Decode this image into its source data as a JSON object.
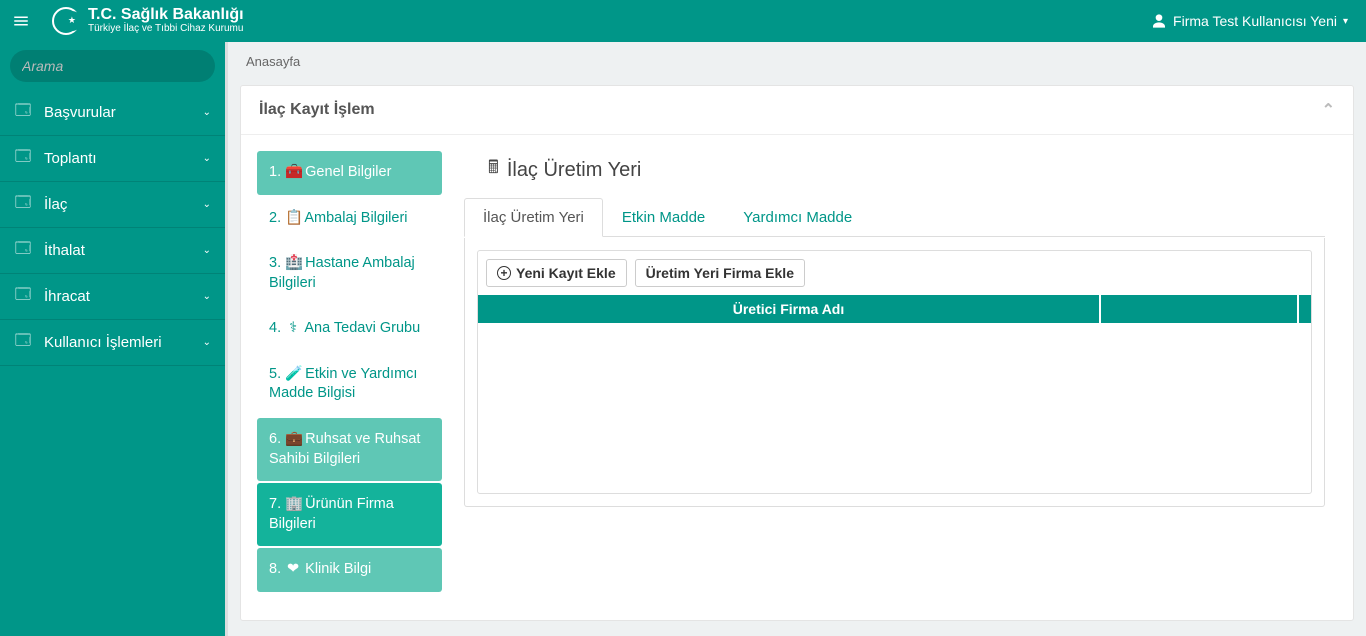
{
  "brand": {
    "line1": "T.C. Sağlık Bakanlığı",
    "line2": "Türkiye İlaç ve Tıbbi Cihaz Kurumu"
  },
  "user": {
    "name": "Firma Test Kullanıcısı Yeni"
  },
  "search": {
    "placeholder": "Arama"
  },
  "nav": [
    {
      "label": "Başvurular"
    },
    {
      "label": "Toplantı"
    },
    {
      "label": "İlaç"
    },
    {
      "label": "İthalat"
    },
    {
      "label": "İhracat"
    },
    {
      "label": "Kullanıcı İşlemleri"
    }
  ],
  "breadcrumb": "Anasayfa",
  "panel": {
    "title": "İlaç Kayıt İşlem"
  },
  "steps": [
    {
      "num": "1.",
      "icon": "🧰",
      "label": "Genel Bilgiler",
      "state": "completed"
    },
    {
      "num": "2.",
      "icon": "📋",
      "label": "Ambalaj Bilgileri",
      "state": ""
    },
    {
      "num": "3.",
      "icon": "🏥",
      "label": "Hastane Ambalaj Bilgileri",
      "state": ""
    },
    {
      "num": "4.",
      "icon": "⚕",
      "label": "Ana Tedavi Grubu",
      "state": ""
    },
    {
      "num": "5.",
      "icon": "🧪",
      "label": "Etkin ve Yardımcı Madde Bilgisi",
      "state": ""
    },
    {
      "num": "6.",
      "icon": "💼",
      "label": "Ruhsat ve Ruhsat Sahibi Bilgileri",
      "state": "completed"
    },
    {
      "num": "7.",
      "icon": "🏢",
      "label": "Ürünün Firma Bilgileri",
      "state": "active"
    },
    {
      "num": "8.",
      "icon": "❤",
      "label": "Klinik Bilgi",
      "state": "completed"
    }
  ],
  "content": {
    "title": "İlaç Üretim Yeri",
    "tabs": [
      {
        "label": "İlaç Üretim Yeri",
        "active": true
      },
      {
        "label": "Etkin Madde",
        "active": false
      },
      {
        "label": "Yardımcı Madde",
        "active": false
      }
    ],
    "buttons": {
      "new": "Yeni Kayıt Ekle",
      "addFirm": "Üretim Yeri Firma Ekle"
    },
    "gridHeader": "Üretici Firma Adı"
  }
}
